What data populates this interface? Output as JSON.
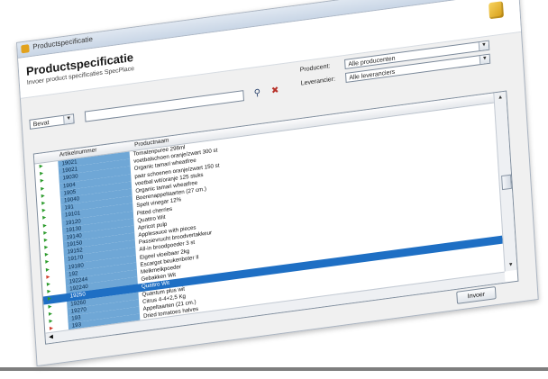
{
  "window": {
    "title": "Productspecificatie",
    "controls": {
      "minimize": "▁",
      "maximize": "□",
      "close": "✕"
    }
  },
  "header": {
    "title": "Productspecificatie",
    "subtitle": "Invoer product specificaties SpecPlace"
  },
  "filters": {
    "left_combo": "Bevat",
    "search_value": "",
    "producent_label": "Producent:",
    "producent_value": "Alle producenten",
    "leverancier_label": "Leverancier:",
    "leverancier_value": "Alle leveranciers"
  },
  "grid": {
    "columns": [
      "Artikelnummer",
      "Productnaam"
    ],
    "rows": [
      {
        "flag": "green",
        "art": "19021",
        "name": "Tomatenpuree 298ml"
      },
      {
        "flag": "green",
        "art": "19021",
        "name": "voetbalschoen oranje/zwart 300 st"
      },
      {
        "flag": "green",
        "art": "19030",
        "name": "Organic tamari wheatfree"
      },
      {
        "flag": "green",
        "art": "1904",
        "name": "paar schoenen oranje/zwart 150 st"
      },
      {
        "flag": "green",
        "art": "1905",
        "name": "voetbal wit/oranje 125 stuks"
      },
      {
        "flag": "green",
        "art": "19040",
        "name": "Organic tamari wheatfree"
      },
      {
        "flag": "green",
        "art": "191",
        "name": "Boerenappeltaarten (27 cm.)"
      },
      {
        "flag": "green",
        "art": "19101",
        "name": "Spelt vinegar 12%"
      },
      {
        "flag": "green",
        "art": "19120",
        "name": "Pitted cherries"
      },
      {
        "flag": "green",
        "art": "19130",
        "name": "Quattro Wit"
      },
      {
        "flag": "green",
        "art": "19140",
        "name": "Apricot pulp"
      },
      {
        "flag": "green",
        "art": "19150",
        "name": "Applesauce with pieces"
      },
      {
        "flag": "green",
        "art": "19152",
        "name": "Passievrucht broodvertakkeur"
      },
      {
        "flag": "green",
        "art": "19170",
        "name": "All-in broodpoeder 3 st"
      },
      {
        "flag": "green",
        "art": "19180",
        "name": "Eigeel vloeibaar 2kg"
      },
      {
        "flag": "red",
        "art": "192",
        "name": "Escargot beukenboter II"
      },
      {
        "flag": "green",
        "art": "192244",
        "name": "Melkmelkpoeder"
      },
      {
        "flag": "green",
        "art": "192240",
        "name": "Gebakken Wit"
      },
      {
        "flag": "green",
        "art": "19250",
        "name": "Quattro Wit",
        "selected": true
      },
      {
        "flag": "green",
        "art": "19260",
        "name": "Quantum plus wit"
      },
      {
        "flag": "green",
        "art": "19270",
        "name": "Citrus 4-4+2,5 Kg"
      },
      {
        "flag": "green",
        "art": "193",
        "name": "Appeltaarten (21 cm.)"
      },
      {
        "flag": "red",
        "art": "193",
        "name": "Dried tomatoes halves"
      },
      {
        "flag": "green",
        "art": "19310",
        "name": "Dried tomatoes halves"
      }
    ]
  },
  "buttons": {
    "invoer": "Invoer"
  },
  "colors": {
    "accent": "#1e6fc4",
    "column_fill": "#6fa7d6"
  }
}
